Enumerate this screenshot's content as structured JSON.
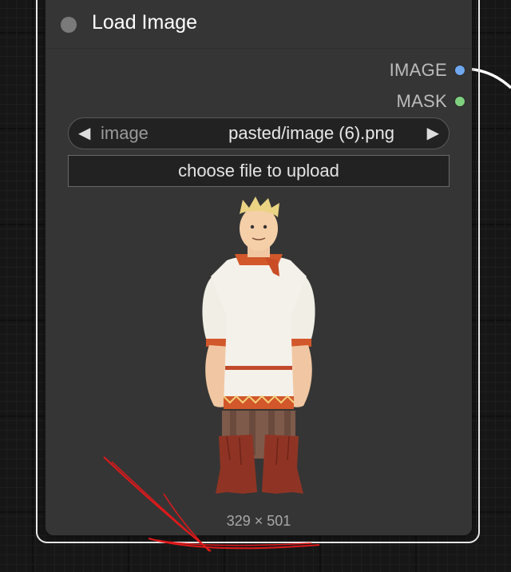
{
  "node": {
    "title": "Load Image",
    "outputs": [
      {
        "label": "IMAGE",
        "color": "#6fa8ef"
      },
      {
        "label": "MASK",
        "color": "#7fd07f"
      }
    ],
    "image_widget": {
      "name": "image",
      "value": "pasted/image (6).png",
      "prev_arrow": "◀",
      "next_arrow": "▶"
    },
    "upload_button_label": "choose file to upload",
    "preview": {
      "subject": "cartoon hero in white embroidered shirt",
      "dimensions_label": "329 × 501"
    }
  },
  "colors": {
    "node_bg": "#353535",
    "selection_outline": "#e8e8e8",
    "annotation_stroke": "#e0191b",
    "wire": "#ffffff"
  }
}
